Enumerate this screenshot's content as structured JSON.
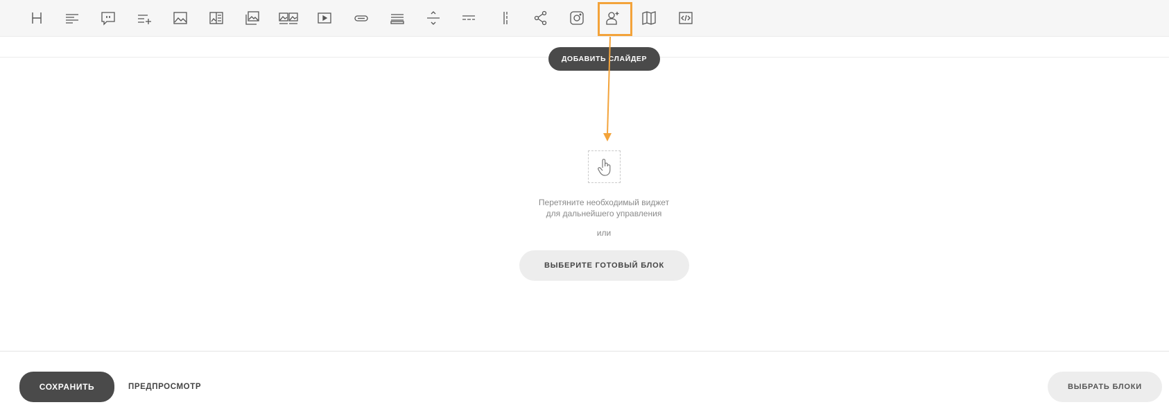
{
  "toolbar": {
    "tools": [
      {
        "icon": "heading-icon"
      },
      {
        "icon": "text-icon"
      },
      {
        "icon": "quote-icon"
      },
      {
        "icon": "list-add-icon"
      },
      {
        "icon": "image-icon"
      },
      {
        "icon": "image-text-icon"
      },
      {
        "icon": "gallery-icon"
      },
      {
        "icon": "image-pair-icon"
      },
      {
        "icon": "video-icon"
      },
      {
        "icon": "button-icon"
      },
      {
        "icon": "lines-icon"
      },
      {
        "icon": "divider-arrows-icon"
      },
      {
        "icon": "dashed-divider-icon"
      },
      {
        "icon": "vertical-divider-icon"
      },
      {
        "icon": "share-icon"
      },
      {
        "icon": "instagram-icon"
      },
      {
        "icon": "add-user-icon",
        "highlighted": true
      },
      {
        "icon": "map-icon"
      },
      {
        "icon": "code-icon"
      }
    ]
  },
  "add_slider_label": "ДОБАВИТЬ СЛАЙДЕР",
  "dropzone": {
    "icon": "hand-pointer-icon",
    "hint_line1": "Перетяните необходимый виджет",
    "hint_line2": "для дальнейшего управления",
    "or_label": "или",
    "choose_block_label": "ВЫБЕРИТЕ ГОТОВЫЙ БЛОК"
  },
  "footer": {
    "save_label": "СОХРАНИТЬ",
    "preview_label": "ПРЕДПРОСМОТР",
    "select_blocks_label": "ВЫБРАТЬ БЛОКИ"
  },
  "colors": {
    "toolbar_bg": "#f6f6f6",
    "highlight": "#f3a33a",
    "dark_button": "#4a4a4a",
    "light_button": "#ededed"
  }
}
